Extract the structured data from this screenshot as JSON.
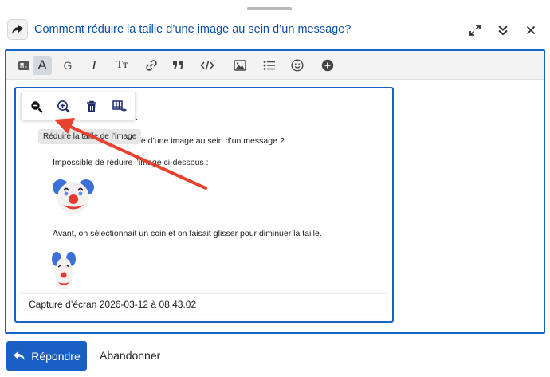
{
  "header": {
    "title": "Comment réduire la taille d’une image au sein d’un message?",
    "reply_icon": "reply-share-icon",
    "expand_icon": "fullscreen-expand-icon",
    "collapse_icon": "double-chevron-down-icon",
    "close_icon": "close-icon"
  },
  "toolbar": {
    "markdown_toggle": "M↓",
    "items": [
      {
        "name": "rich-text-toggle",
        "glyph": "A",
        "active": true
      },
      {
        "name": "heading",
        "glyph": "G"
      },
      {
        "name": "italic",
        "glyph": "I"
      },
      {
        "name": "font-size",
        "glyph": "Tт"
      },
      {
        "name": "link"
      },
      {
        "name": "blockquote"
      },
      {
        "name": "code"
      },
      {
        "name": "image"
      },
      {
        "name": "bullet-list"
      },
      {
        "name": "emoji"
      },
      {
        "name": "more"
      }
    ]
  },
  "editor": {
    "line1_partial": "sous.",
    "line2": "Comment réduire la taille d’une image au sein d’un message ?",
    "line3": "Impossible de réduire l’image ci-dessous :",
    "line4": "Avant, on sélectionnait un coin et on faisait glisser pour diminuer la taille.",
    "caption": "Capture d’écran 2026-03-12 à 08.43.02",
    "tooltip": "Réduire la taille de l’image",
    "image_toolbar": [
      "zoom-out-icon",
      "zoom-in-icon",
      "trash-icon",
      "table-add-icon"
    ]
  },
  "footer": {
    "reply_label": "Répondre",
    "cancel_label": "Abandonner"
  },
  "colors": {
    "accent": "#1a5fc4",
    "title": "#0a4ea8",
    "annotation_arrow": "#e8422f"
  }
}
